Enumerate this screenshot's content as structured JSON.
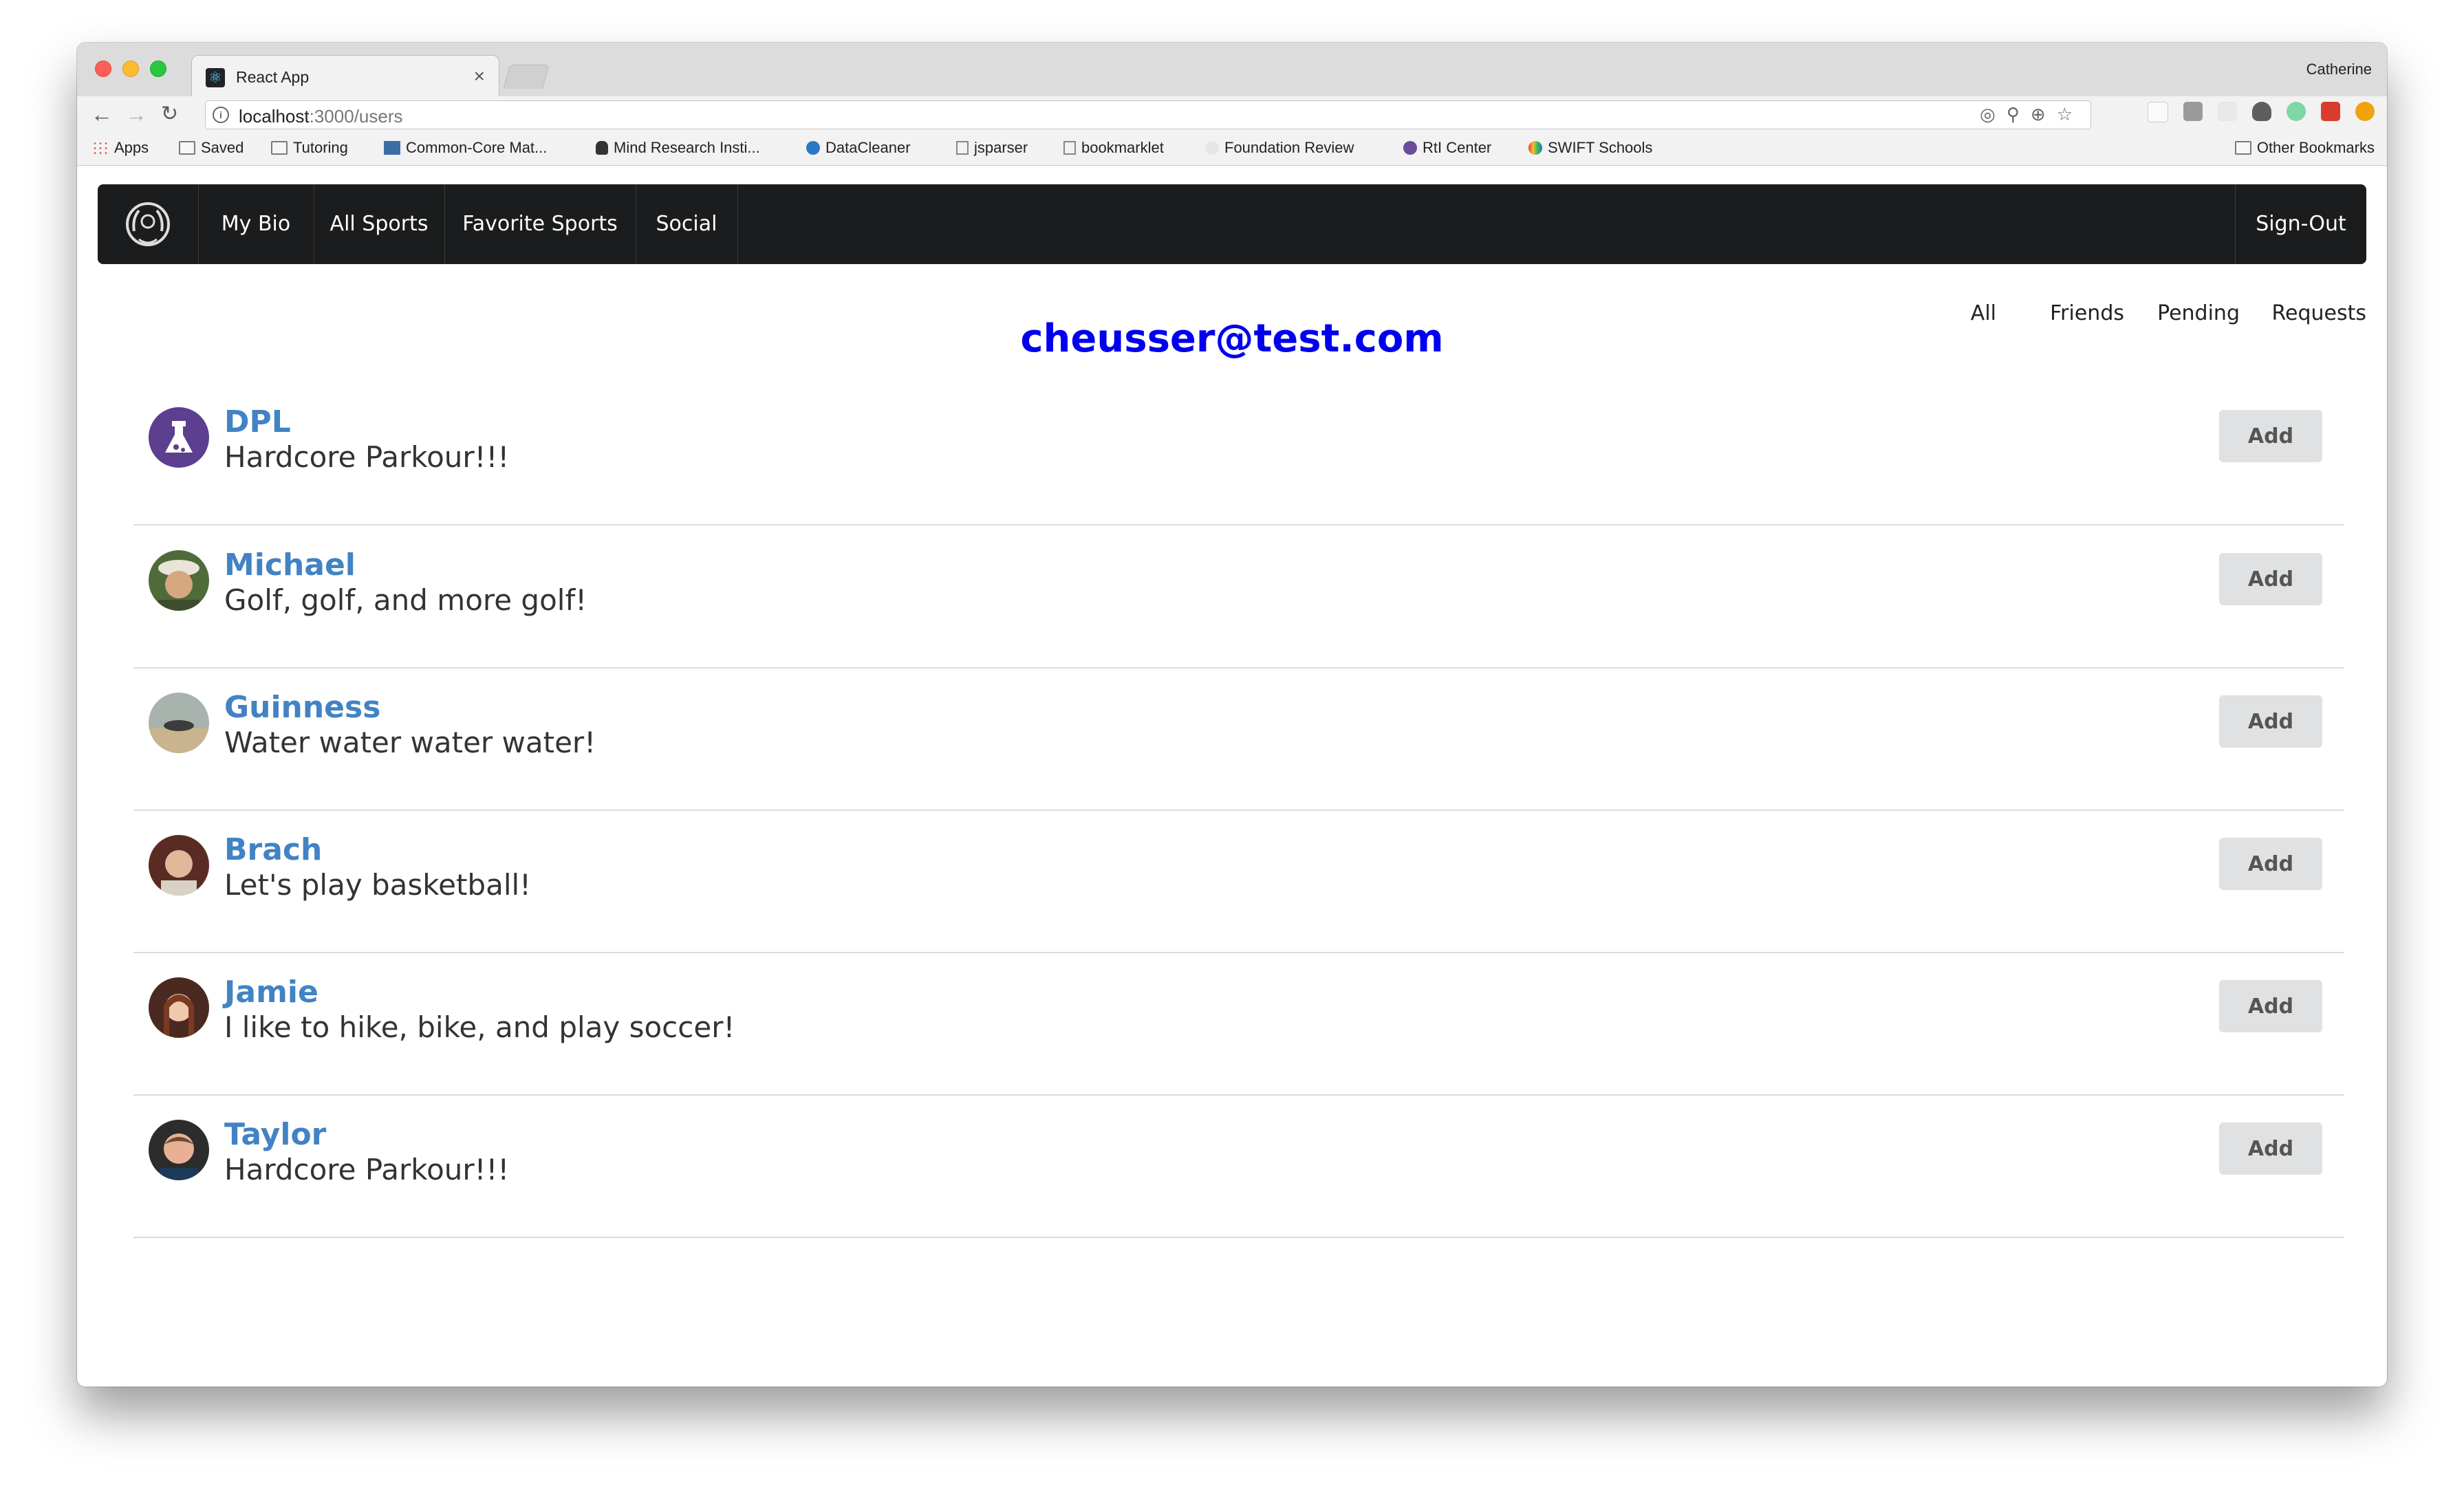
{
  "browser": {
    "tab_title": "React App",
    "tab_close": "×",
    "profile_name": "Catherine",
    "url_host": "localhost",
    "url_path": ":3000/users",
    "bookmarks": [
      "Apps",
      "Saved",
      "Tutoring",
      "Common-Core Mat...",
      "Mind Research Insti...",
      "DataCleaner",
      "jsparser",
      "bookmarklet",
      "Foundation Review",
      "RtI Center",
      "SWIFT Schools"
    ],
    "other_bookmarks": "Other Bookmarks"
  },
  "navbar": {
    "items": [
      "My Bio",
      "All Sports",
      "Favorite Sports",
      "Social"
    ],
    "signout": "Sign-Out"
  },
  "filters": [
    "All",
    "Friends",
    "Pending",
    "Requests"
  ],
  "page_title": "cheusser@test.com",
  "add_label": "Add",
  "users": [
    {
      "name": "DPL",
      "bio": "Hardcore Parkour!!!"
    },
    {
      "name": "Michael",
      "bio": "Golf, golf, and more golf!"
    },
    {
      "name": "Guinness",
      "bio": "Water water water water!"
    },
    {
      "name": "Brach",
      "bio": "Let's play basketball!"
    },
    {
      "name": "Jamie",
      "bio": "I like to hike, bike, and play soccer!"
    },
    {
      "name": "Taylor",
      "bio": "Hardcore Parkour!!!"
    }
  ],
  "colors": {
    "link": "#4183c4",
    "title": "#0000ee",
    "navbar_bg": "#1b1c1d",
    "button_bg": "#e0e1e2"
  }
}
